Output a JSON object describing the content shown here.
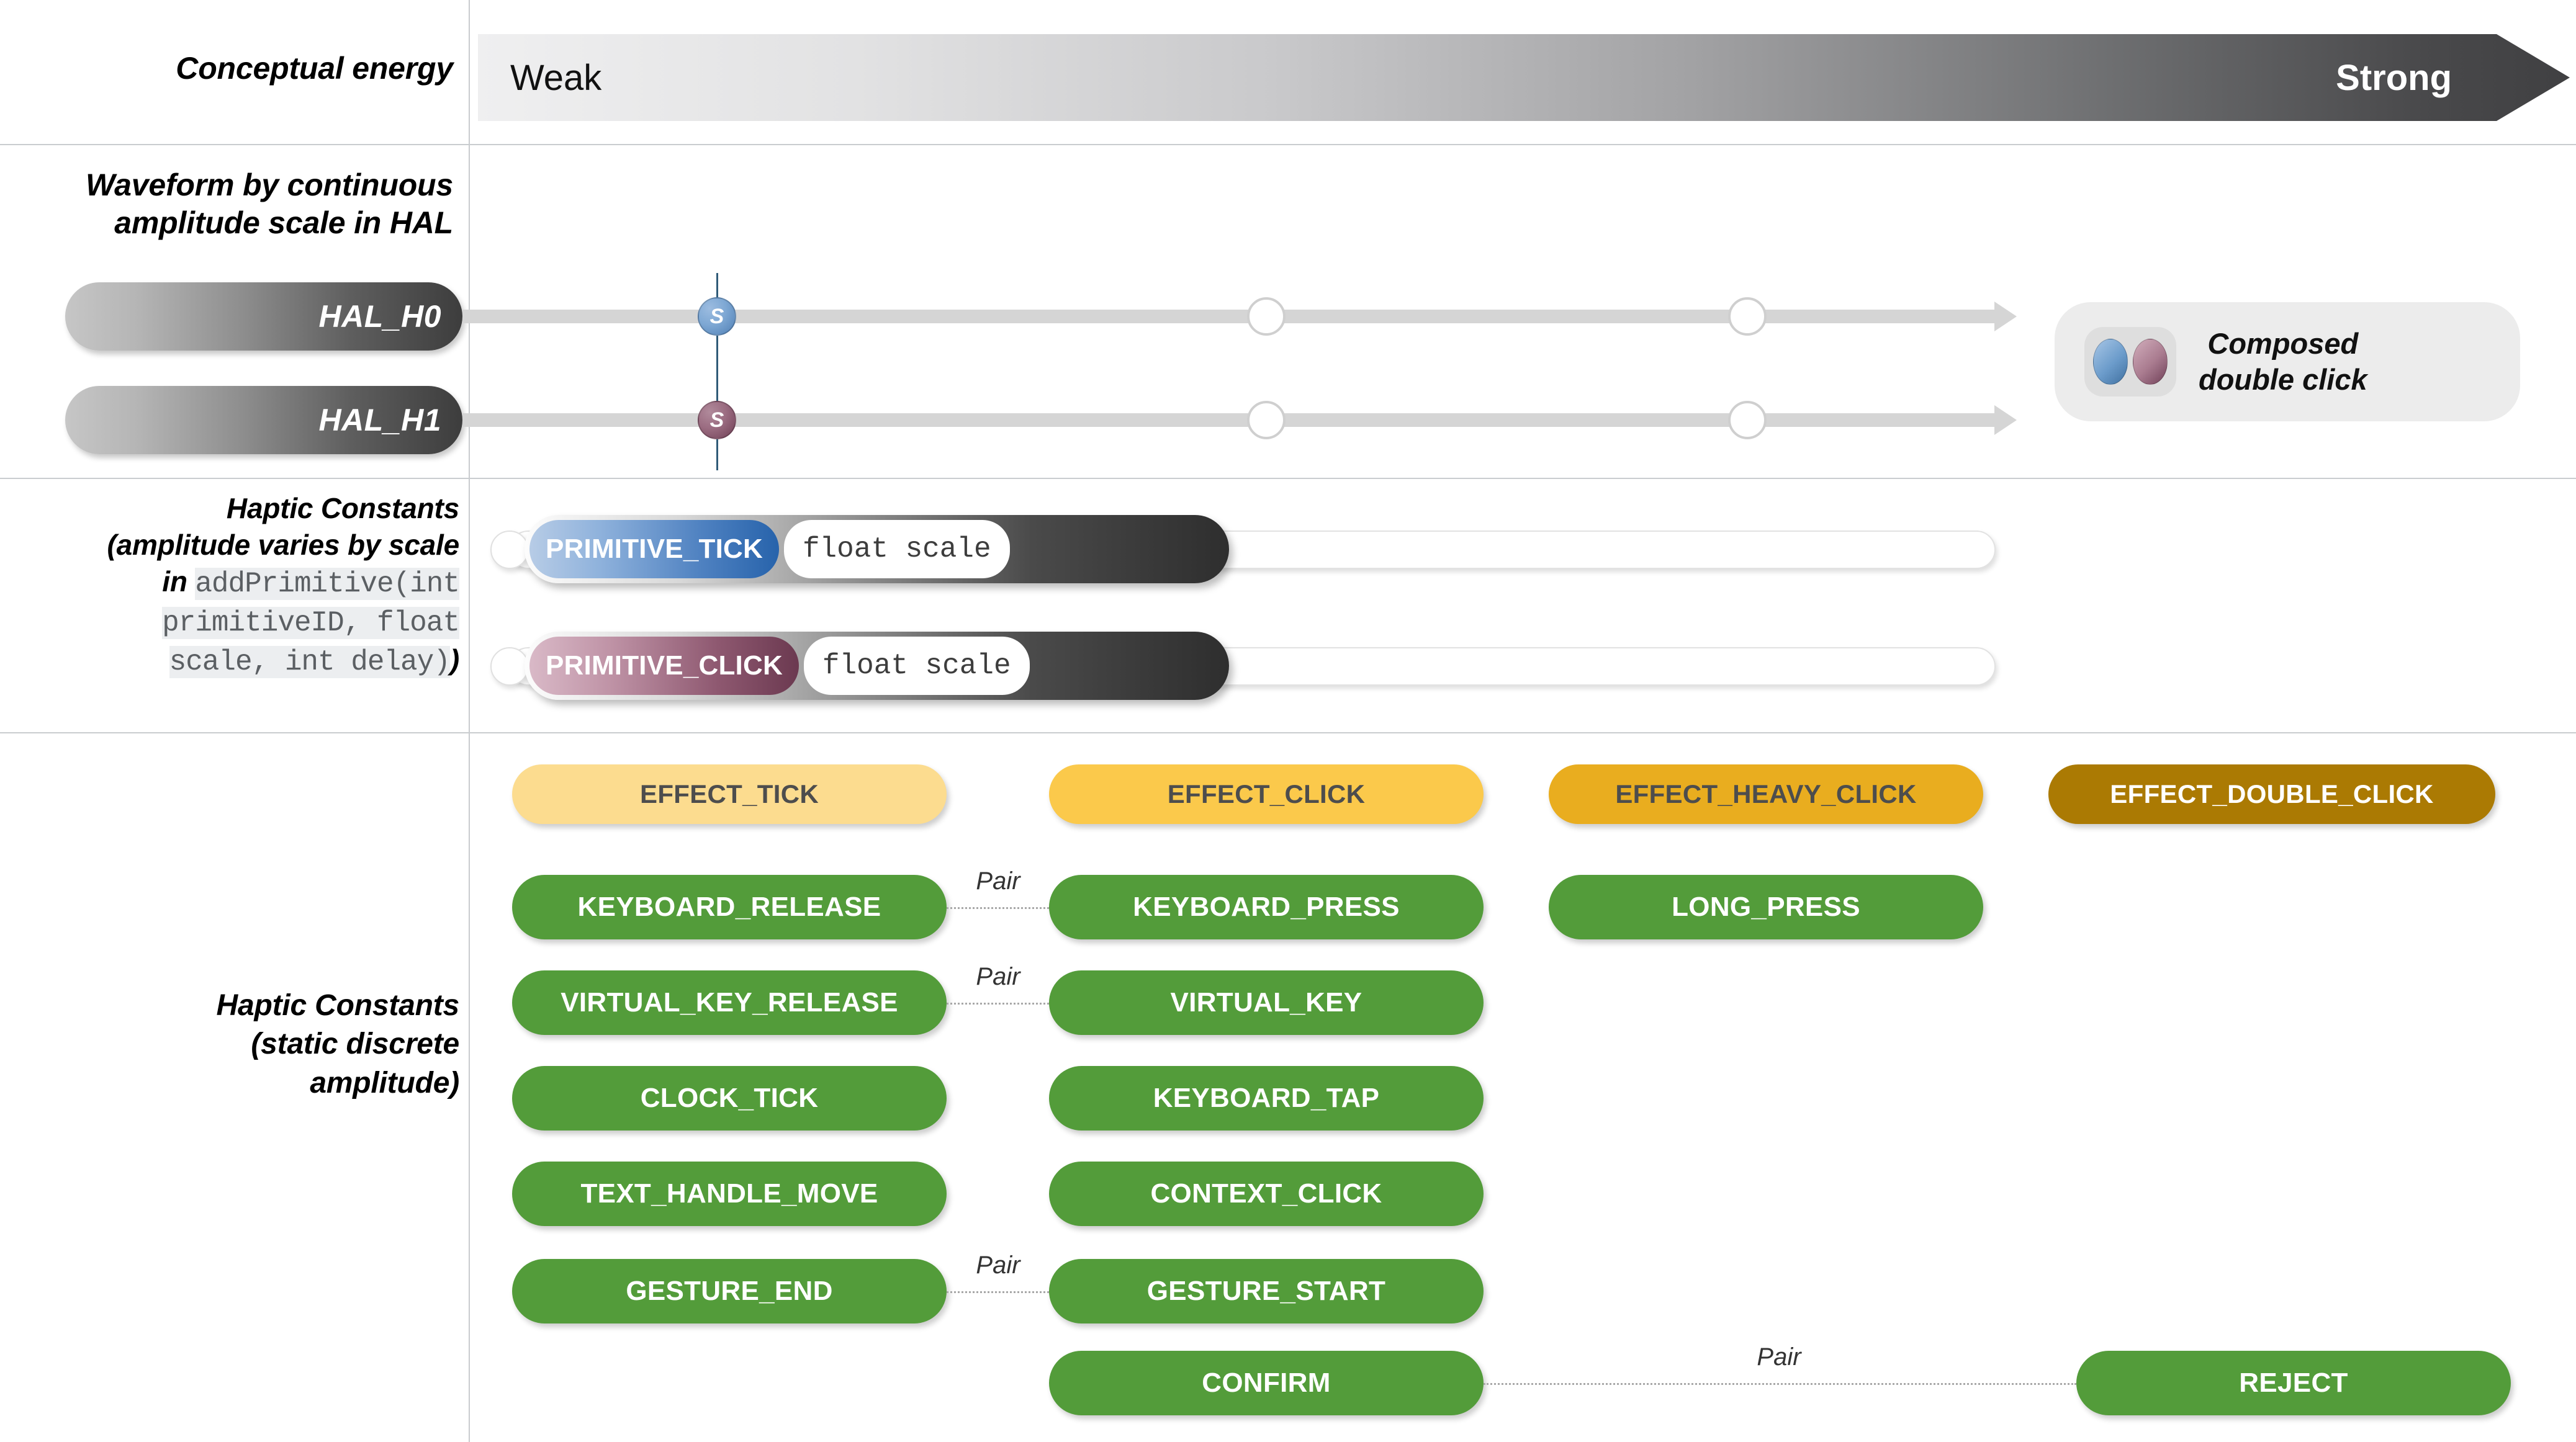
{
  "rows": {
    "conceptual_energy_label": "Conceptual energy",
    "waveform_label_line1": "Waveform by continuous",
    "waveform_label_line2": "amplitude scale in HAL",
    "haptic_varies_label_line1": "Haptic Constants",
    "haptic_varies_label_line2": "(amplitude varies by scale",
    "haptic_varies_label_in": "in ",
    "haptic_varies_code_line1": "addPrimitive(int",
    "haptic_varies_code_line2": "primitiveID, float",
    "haptic_varies_code_line3": "scale, int delay)",
    "haptic_varies_label_close": ")",
    "haptic_static_label_line1": "Haptic Constants",
    "haptic_static_label_line2": "(static discrete",
    "haptic_static_label_line3": "amplitude)"
  },
  "energy": {
    "weak": "Weak",
    "strong": "Strong"
  },
  "hal": {
    "h0": {
      "name": "HAL_H0",
      "marker": "S",
      "marker_color": "#4f7fb5"
    },
    "h1": {
      "name": "HAL_H1",
      "marker": "S",
      "marker_color": "#6f3f55"
    }
  },
  "composed": {
    "line1": "Composed",
    "line2": "double click"
  },
  "primitives": [
    {
      "name": "PRIMITIVE_TICK",
      "arg": "float scale",
      "color": "#2763ab"
    },
    {
      "name": "PRIMITIVE_CLICK",
      "arg": "float scale",
      "color": "#6b3950"
    }
  ],
  "effects": [
    {
      "label": "EFFECT_TICK",
      "bg": "#fcdc8f",
      "fg": "#4d4d4d"
    },
    {
      "label": "EFFECT_CLICK",
      "bg": "#fbc94b",
      "fg": "#4d4d4d"
    },
    {
      "label": "EFFECT_HEAVY_CLICK",
      "bg": "#e9ad1f",
      "fg": "#4d4d4d"
    },
    {
      "label": "EFFECT_DOUBLE_CLICK",
      "bg": "#ab7a03",
      "fg": "#ffffff"
    }
  ],
  "constants": {
    "color": "#539c3a",
    "col1": [
      "KEYBOARD_RELEASE",
      "VIRTUAL_KEY_RELEASE",
      "CLOCK_TICK",
      "TEXT_HANDLE_MOVE",
      "GESTURE_END"
    ],
    "col2": [
      "KEYBOARD_PRESS",
      "VIRTUAL_KEY",
      "KEYBOARD_TAP",
      "CONTEXT_CLICK",
      "GESTURE_START",
      "CONFIRM"
    ],
    "col3": [
      "LONG_PRESS"
    ],
    "col4": [
      "REJECT"
    ]
  },
  "pair_label": "Pair",
  "pairs": [
    {
      "label": "Pair",
      "left": "KEYBOARD_RELEASE",
      "right": "KEYBOARD_PRESS"
    },
    {
      "label": "Pair",
      "left": "VIRTUAL_KEY_RELEASE",
      "right": "VIRTUAL_KEY"
    },
    {
      "label": "Pair",
      "left": "GESTURE_END",
      "right": "GESTURE_START"
    },
    {
      "label": "Pair",
      "left": "CONFIRM",
      "right": "REJECT"
    }
  ]
}
